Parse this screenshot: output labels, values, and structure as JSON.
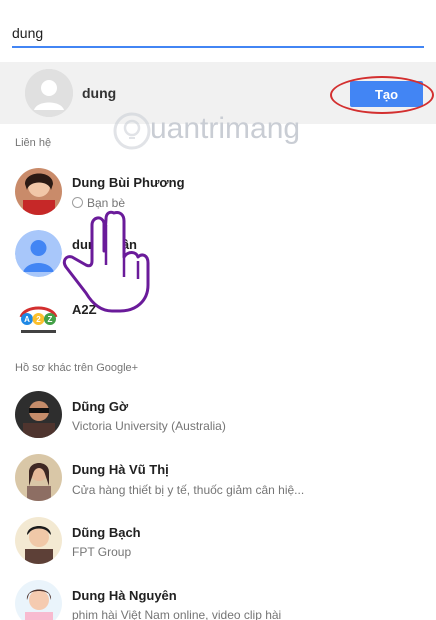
{
  "search": {
    "value": "dung"
  },
  "create": {
    "name": "dung",
    "button_label": "Tạo"
  },
  "sections": {
    "contacts_label": "Liên hệ",
    "others_label": "Hồ sơ khác trên Google+"
  },
  "contacts": [
    {
      "name": "Dung Bùi Phương",
      "sub": "Bạn bè"
    },
    {
      "name": "dung ... ần",
      "sub": ""
    },
    {
      "name": "A2Z",
      "sub": ""
    }
  ],
  "profiles": [
    {
      "name": "Dũng Gờ",
      "sub": "Victoria University (Australia)"
    },
    {
      "name": "Dung Hà Vũ Thị",
      "sub": "Cửa hàng thiết bị y tế, thuốc giảm cân hiệ..."
    },
    {
      "name": "Dũng Bạch",
      "sub": "FPT Group"
    },
    {
      "name": "Dung Hà Nguyên",
      "sub": "phim hài Việt Nam online, video clip hài"
    }
  ],
  "watermark": {
    "text": "uantrimang"
  },
  "colors": {
    "accent": "#4285f4",
    "highlight": "#d32f2f",
    "row_bg": "#f1f1f1"
  }
}
